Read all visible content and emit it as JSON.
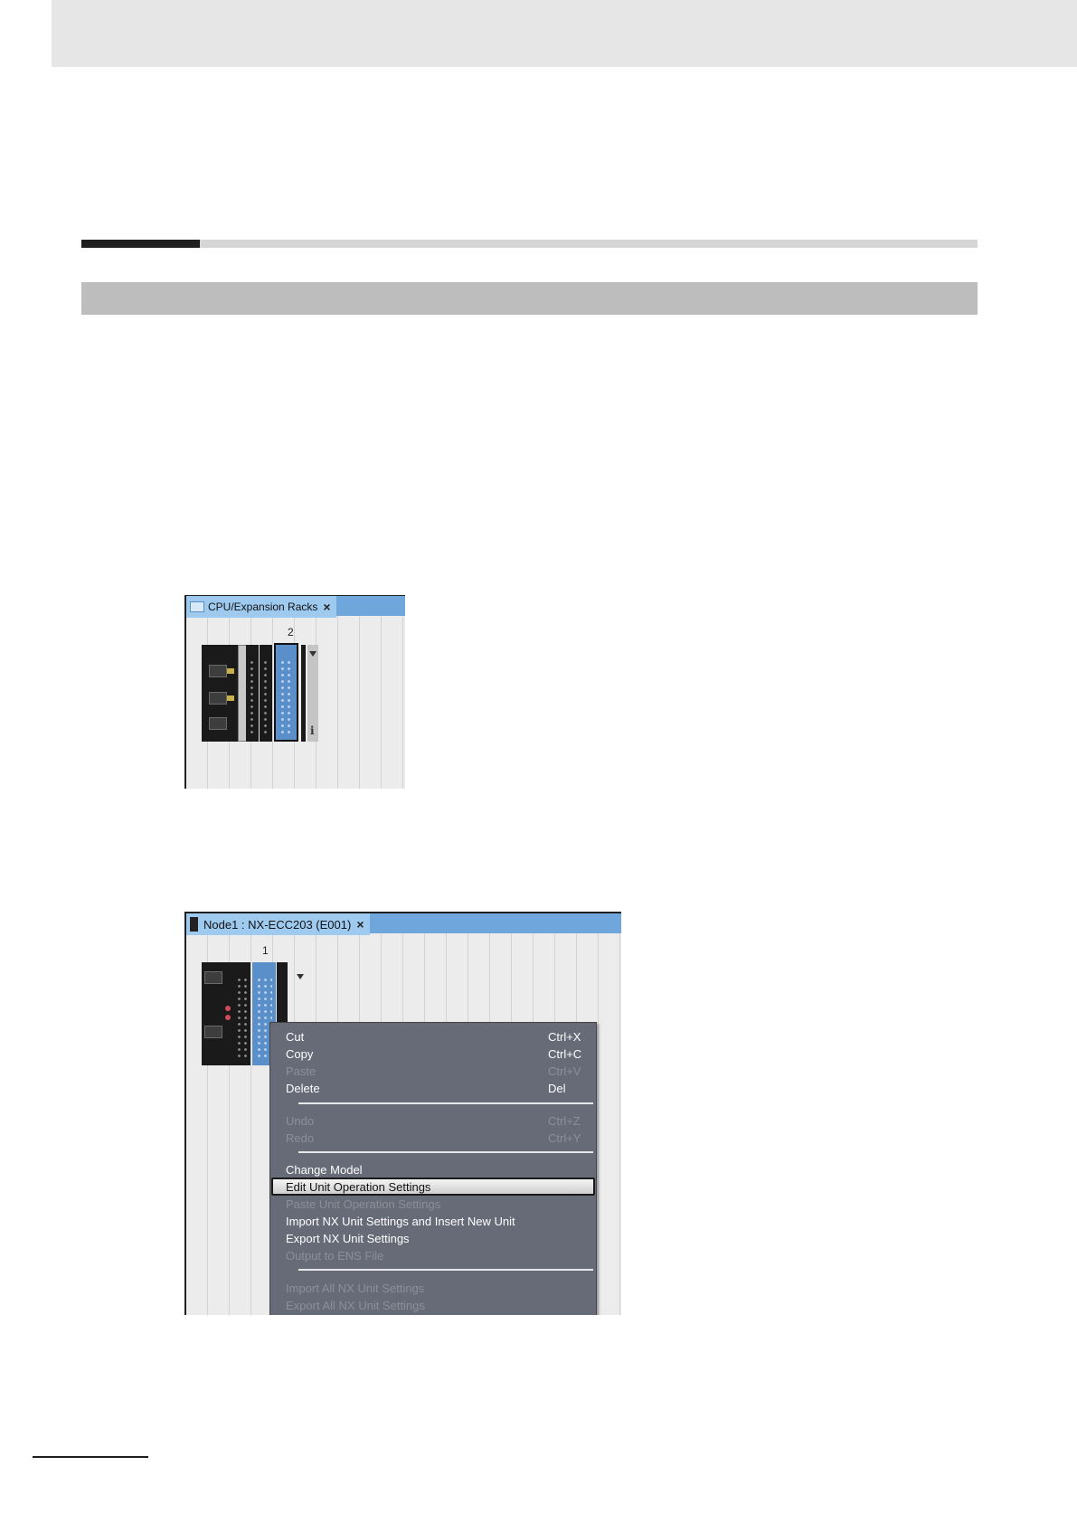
{
  "screenshot1": {
    "tab_title": "CPU/Expansion Racks",
    "tab_close": "×",
    "slot_number": "2",
    "info_glyph": "i"
  },
  "screenshot2": {
    "tab_title": "Node1 : NX-ECC203 (E001)",
    "tab_close": "×",
    "slot_number": "1",
    "menu": {
      "cut": {
        "label": "Cut",
        "shortcut": "Ctrl+X"
      },
      "copy": {
        "label": "Copy",
        "shortcut": "Ctrl+C"
      },
      "paste": {
        "label": "Paste",
        "shortcut": "Ctrl+V"
      },
      "delete": {
        "label": "Delete",
        "shortcut": "Del"
      },
      "undo": {
        "label": "Undo",
        "shortcut": "Ctrl+Z"
      },
      "redo": {
        "label": "Redo",
        "shortcut": "Ctrl+Y"
      },
      "change_model": "Change Model",
      "edit_unit_operation_settings": "Edit Unit Operation Settings",
      "paste_unit_operation_settings": "Paste Unit Operation Settings",
      "import_nx_unit_settings_insert": "Import NX Unit Settings and Insert New Unit",
      "export_nx_unit_settings": "Export NX Unit Settings",
      "output_to_ens_file": "Output to ENS File",
      "import_all_nx_unit_settings": "Import All NX Unit Settings",
      "export_all_nx_unit_settings": "Export All NX Unit Settings"
    }
  },
  "colors": {
    "tab_active": "#9fcaf0",
    "tab_strip": "#6fa6dc",
    "menu_background": "#676b78",
    "unit_selected": "#5b8fc9"
  }
}
